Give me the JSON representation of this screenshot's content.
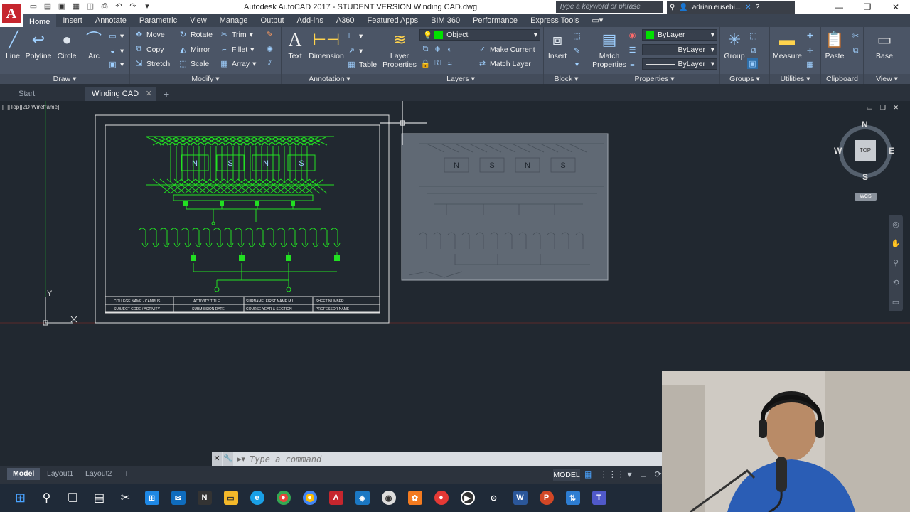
{
  "window": {
    "title": "Autodesk AutoCAD 2017 - STUDENT VERSION    Winding CAD.dwg",
    "search_placeholder": "Type a keyword or phrase",
    "user": "adrian.eusebi..."
  },
  "ribbon_tabs": [
    "Home",
    "Insert",
    "Annotate",
    "Parametric",
    "View",
    "Manage",
    "Output",
    "Add-ins",
    "A360",
    "Featured Apps",
    "BIM 360",
    "Performance",
    "Express Tools"
  ],
  "ribbon": {
    "draw": {
      "line": "Line",
      "polyline": "Polyline",
      "circle": "Circle",
      "arc": "Arc",
      "label": "Draw"
    },
    "modify": {
      "move": "Move",
      "rotate": "Rotate",
      "trim": "Trim",
      "copy": "Copy",
      "mirror": "Mirror",
      "fillet": "Fillet",
      "stretch": "Stretch",
      "scale": "Scale",
      "array": "Array",
      "label": "Modify"
    },
    "annotation": {
      "text": "Text",
      "dimension": "Dimension",
      "table": "Table",
      "label": "Annotation"
    },
    "layers": {
      "layer_properties": "Layer Properties",
      "current_layer": "Object",
      "make_current": "Make Current",
      "match_layer": "Match Layer",
      "label": "Layers"
    },
    "block": {
      "insert": "Insert",
      "label": "Block"
    },
    "properties": {
      "match_properties": "Match Properties",
      "color": "ByLayer",
      "linetype": "ByLayer",
      "lineweight": "ByLayer",
      "label": "Properties",
      "color_hex": "#00e000"
    },
    "groups": {
      "group": "Group",
      "label": "Groups"
    },
    "utilities": {
      "measure": "Measure",
      "label": "Utilities"
    },
    "clipboard": {
      "paste": "Paste",
      "label": "Clipboard"
    },
    "view": {
      "base": "Base",
      "label": "View"
    }
  },
  "doc_tabs": [
    "Start",
    "Winding CAD"
  ],
  "viewport_label": "[−][Top][2D Wireframe]",
  "viewcube": {
    "n": "N",
    "s": "S",
    "e": "E",
    "w": "W",
    "top": "TOP",
    "wcs": "WCS"
  },
  "drawing": {
    "poles_top": [
      "N",
      "S",
      "N",
      "S"
    ],
    "title_block": {
      "r1": [
        "COLLEGE NAME - CAMPUS",
        "ACTIVITY TITLE",
        "SURNAME, FIRST NAME M.I.",
        "SHEET NUMBER"
      ],
      "r2": [
        "SUBJECT CODE / ACTIVITY",
        "SUBMISSION DATE",
        "COURSE YEAR & SECTION",
        "PROFESSOR NAME"
      ]
    },
    "ucs_y": "Y"
  },
  "command_prompt": "Type a command",
  "layout_tabs": [
    "Model",
    "Layout1",
    "Layout2"
  ],
  "status": {
    "model": "MODEL"
  }
}
